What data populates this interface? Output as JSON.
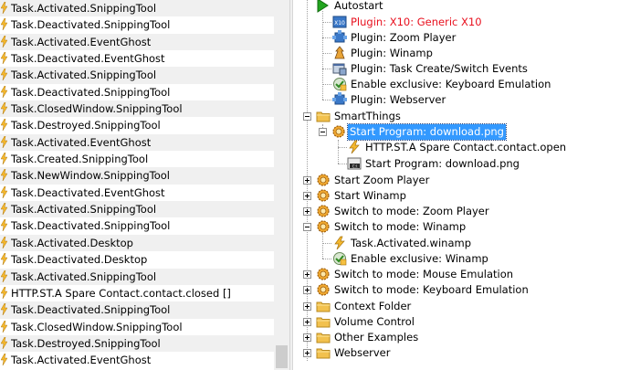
{
  "log": {
    "entries": [
      "Task.Activated.SnippingTool",
      "Task.Deactivated.SnippingTool",
      "Task.Activated.EventGhost",
      "Task.Deactivated.EventGhost",
      "Task.Activated.SnippingTool",
      "Task.Deactivated.SnippingTool",
      "Task.ClosedWindow.SnippingTool",
      "Task.Destroyed.SnippingTool",
      "Task.Activated.EventGhost",
      "Task.Created.SnippingTool",
      "Task.NewWindow.SnippingTool",
      "Task.Deactivated.EventGhost",
      "Task.Activated.SnippingTool",
      "Task.Deactivated.SnippingTool",
      "Task.Activated.Desktop",
      "Task.Deactivated.Desktop",
      "Task.Activated.SnippingTool",
      "HTTP.ST.A Spare Contact.contact.closed []",
      "Task.Deactivated.SnippingTool",
      "Task.ClosedWindow.SnippingTool",
      "Task.Destroyed.SnippingTool",
      "Task.Activated.EventGhost"
    ]
  },
  "tree": {
    "autostart": "Autostart",
    "plugin_x10": "Plugin: X10: Generic X10",
    "plugin_zoom": "Plugin: Zoom Player",
    "plugin_winamp": "Plugin: Winamp",
    "plugin_task": "Plugin: Task Create/Switch Events",
    "enable_keyboard": "Enable exclusive: Keyboard Emulation",
    "plugin_webserver": "Plugin: Webserver",
    "smartthings": "SmartThings",
    "start_program_selected": "Start Program: download.png",
    "http_event": "HTTP.ST.A Spare Contact.contact.open",
    "start_program_action": "Start Program: download.png",
    "start_zoom": "Start Zoom Player",
    "start_winamp": "Start Winamp",
    "switch_zoom": "Switch to mode: Zoom Player",
    "switch_winamp": "Switch to mode: Winamp",
    "task_winamp": "Task.Activated.winamp",
    "enable_winamp": "Enable exclusive: Winamp",
    "switch_mouse": "Switch to mode: Mouse Emulation",
    "switch_keyboard": "Switch to mode: Keyboard Emulation",
    "context_folder": "Context Folder",
    "volume_control": "Volume Control",
    "other_examples": "Other Examples",
    "webserver": "Webserver"
  },
  "colors": {
    "selection": "#3399ff",
    "disabled_red": "#e8101e",
    "folder": "#f2c14e",
    "macro_gear": "#e89a1c"
  }
}
